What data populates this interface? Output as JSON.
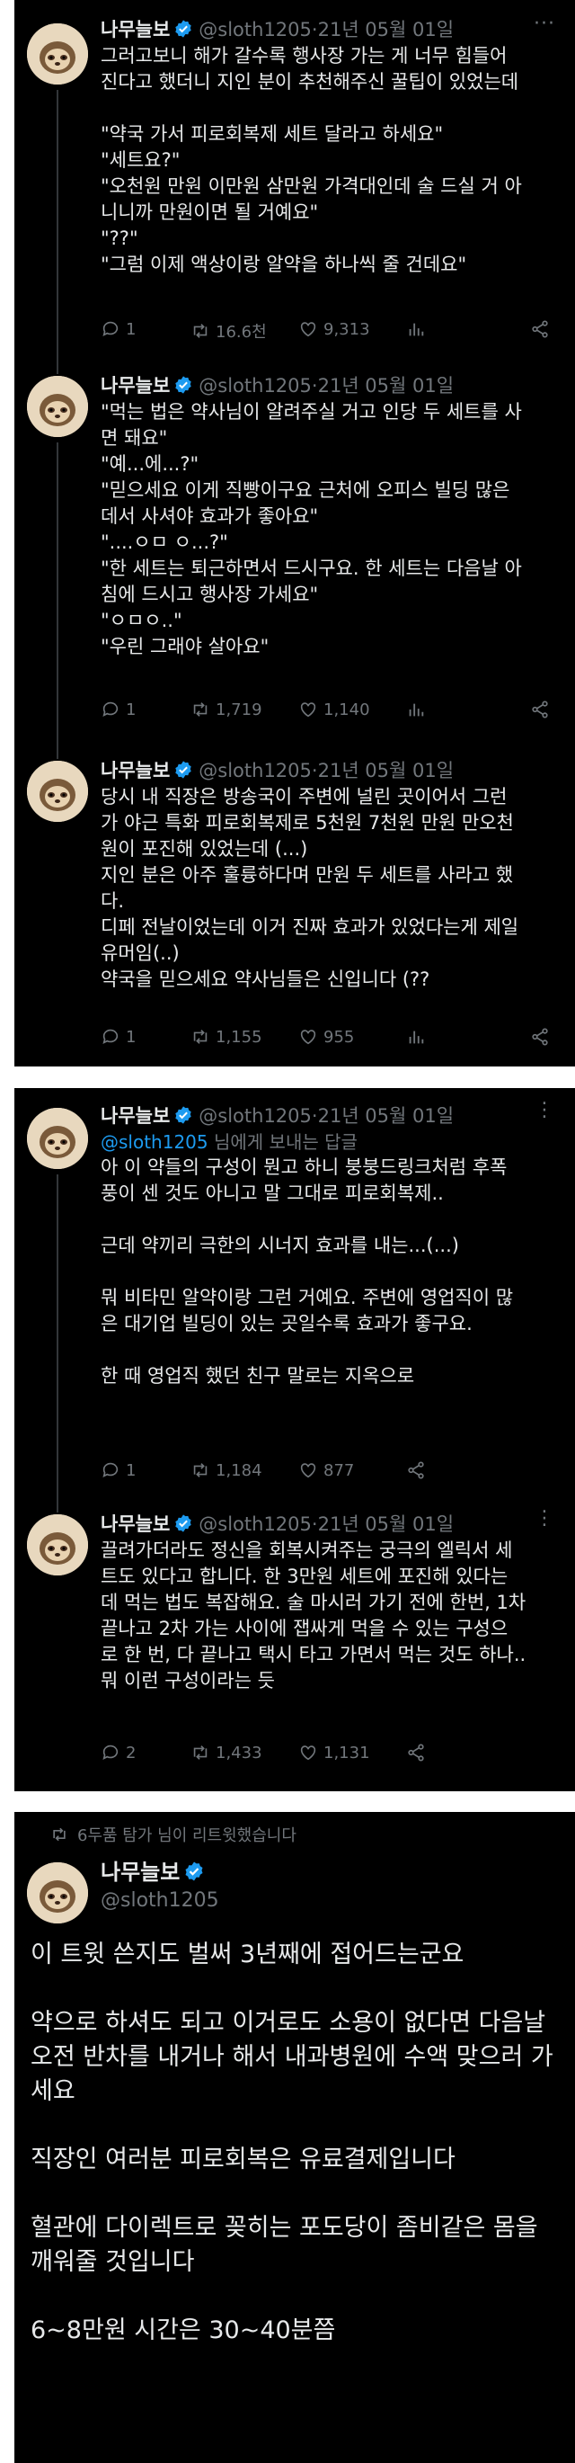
{
  "author": {
    "name": "나무늘보",
    "handle": "@sloth1205",
    "date": "21년 05월 01일",
    "separator": "·"
  },
  "tweets": [
    {
      "lines": [
        "그러고보니 해가 갈수록 행사장 가는 게 너무 힘들어",
        "진다고 했더니 지인 분이 추천해주신 꿀팁이 있었는데",
        "",
        "\"약국 가서 피로회복제 세트 달라고 하세요\"",
        "\"세트요?\"",
        "\"오천원 만원 이만원 삼만원 가격대인데 술 드실 거 아",
        "니니까 만원이면 될 거예요\"",
        "\"??\"",
        "\"그럼 이제 액상이랑 알약을 하나씩 줄 건데요\""
      ],
      "replies": "1",
      "retweets": "16.6천",
      "likes": "9,313"
    },
    {
      "lines": [
        "\"먹는 법은 약사님이 알려주실 거고 인당 두 세트를 사",
        "면 돼요\"",
        "\"예...에...?\"",
        "\"믿으세요 이게 직빵이구요 근처에 오피스 빌딩 많은",
        "데서 사셔야 효과가 좋아요\"",
        "\"....ㅇㅁ ㅇ...?\"",
        "\"한 세트는 퇴근하면서 드시구요. 한 세트는 다음날 아",
        "침에 드시고 행사장 가세요\"",
        "\"ㅇㅁㅇ..\"",
        "\"우린 그래야 살아요\""
      ],
      "replies": "1",
      "retweets": "1,719",
      "likes": "1,140"
    },
    {
      "lines": [
        "당시 내 직장은 방송국이 주변에 널린 곳이어서 그런",
        "가 야근 특화 피로회복제로 5천원 7천원 만원 만오천",
        "원이 포진해 있었는데 (...)",
        "지인 분은 아주 훌륭하다며 만원 두 세트를 사라고 했",
        "다.",
        "디페 전날이었는데 이거 진짜 효과가 있었다는게 제일",
        "유머임(..)",
        "약국을 믿으세요 약사님들은 신입니다 (??"
      ],
      "replies": "1",
      "retweets": "1,155",
      "likes": "955"
    },
    {
      "reply_prefix": "@sloth1205",
      "reply_suffix": "님에게 보내는 답글",
      "lines": [
        "아 이 약들의 구성이 뭔고 하니 붕붕드링크처럼 후폭",
        "풍이 센 것도 아니고 말 그대로 피로회복제..",
        "",
        "근데 약끼리 극한의 시너지 효과를 내는...(...)",
        "",
        "뭐 비타민 알약이랑 그런 거예요. 주변에 영업직이 많",
        "은 대기업 빌딩이 있는 곳일수록 효과가 좋구요.",
        "",
        "한 때 영업직 했던 친구 말로는 지옥으로"
      ],
      "replies": "1",
      "retweets": "1,184",
      "likes": "877"
    },
    {
      "lines": [
        "끌려가더라도 정신을 회복시켜주는 궁극의 엘릭서 세",
        "트도 있다고 합니다. 한 3만원 세트에 포진해 있다는",
        "데 먹는 법도 복잡해요. 술 마시러 가기 전에 한번, 1차",
        "끝나고 2차 가는 사이에 잽싸게 먹을 수 있는 구성으",
        "로 한 번, 다 끝나고 택시 타고 가면서 먹는 것도 하나..",
        "뭐 이런 구성이라는 듯"
      ],
      "replies": "2",
      "retweets": "1,433",
      "likes": "1,131"
    }
  ],
  "final_tweet": {
    "retweet_note": "6두품 탐가 님이 리트윗했습니다",
    "lines": [
      "이 트윗 쓴지도 벌써 3년째에 접어드는군요",
      "",
      "약으로 하셔도 되고 이거로도 소용이 없다면 다음날",
      "오전 반차를 내거나 해서 내과병원에 수액 맞으러 가",
      "세요",
      "",
      "직장인 여러분 피로회복은 유료결제입니다",
      "",
      "혈관에 다이렉트로 꽂히는 포도당이 좀비같은 몸을",
      "깨워줄 것입니다",
      "",
      "6~8만원 시간은 30~40분쯤"
    ]
  },
  "colors": {
    "background": "#000000",
    "text": "#e7e9ea",
    "muted": "#71767b",
    "accent": "#1d9bf0"
  },
  "icons": {
    "reply": "reply-icon",
    "retweet": "retweet-icon",
    "like": "like-icon",
    "views": "views-icon",
    "share": "share-icon",
    "verified": "verified-badge-icon",
    "more": "more-icon"
  }
}
